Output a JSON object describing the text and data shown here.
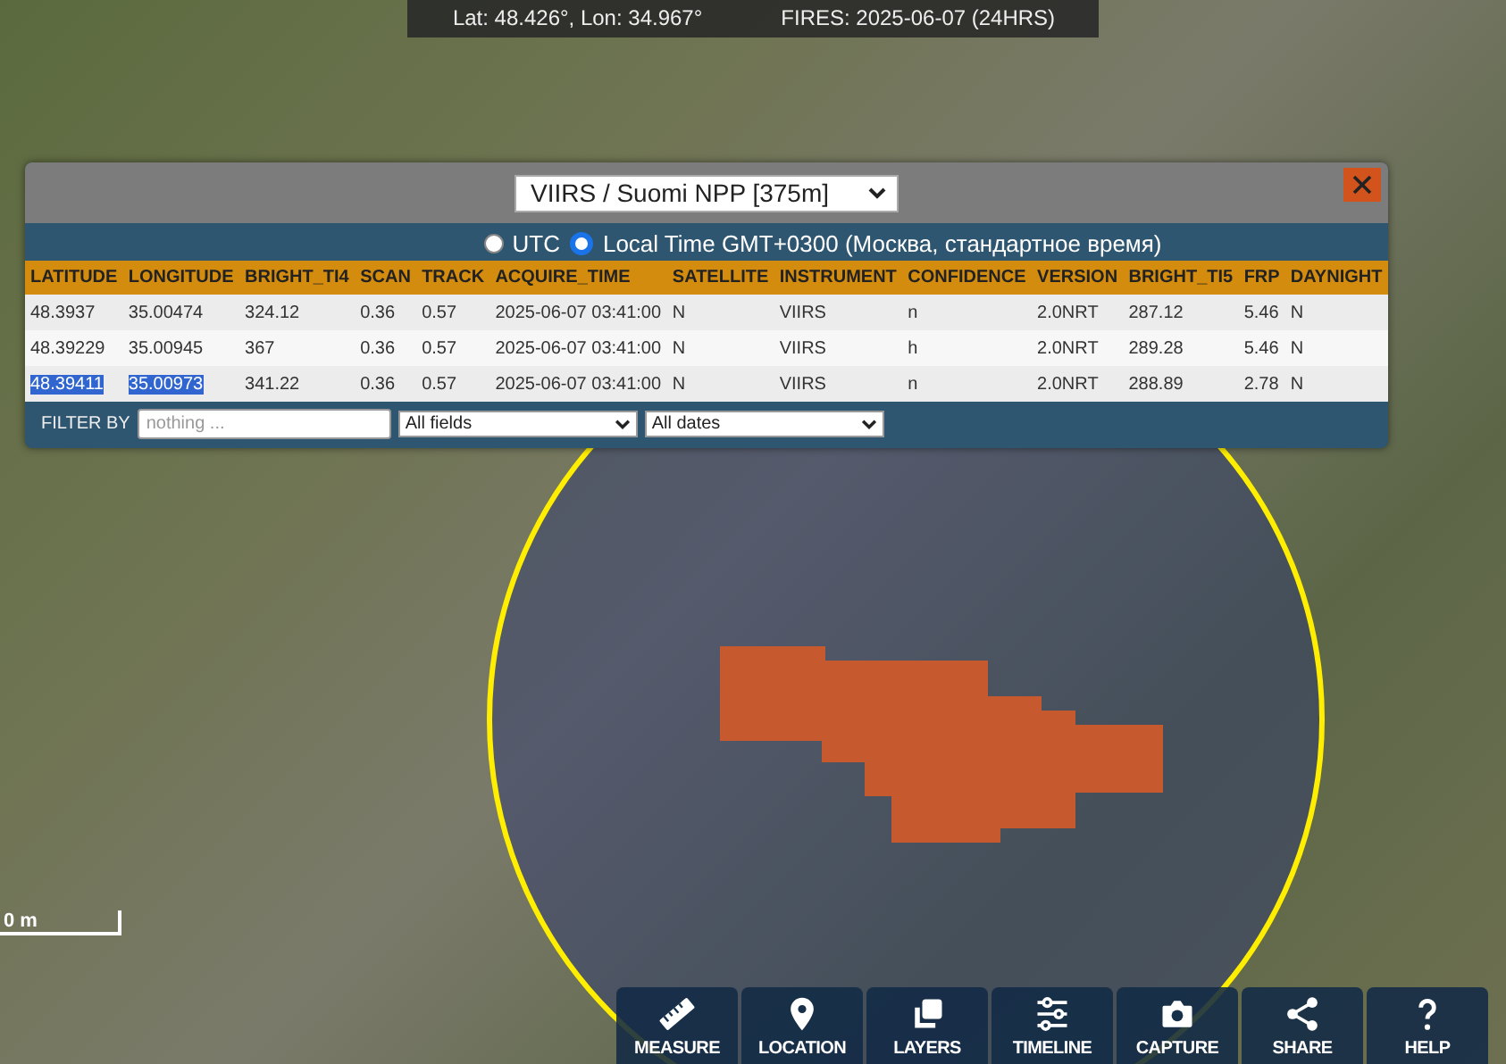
{
  "status_bar": {
    "coordinates": "Lat: 48.426°, Lon: 34.967°",
    "fires": "FIRES: 2025-06-07 (24HRS)"
  },
  "panel": {
    "source_select": "VIIRS / Suomi NPP [375m]",
    "time_options": [
      {
        "label": "UTC",
        "selected": false
      },
      {
        "label": "Local Time GMT+0300 (Москва, стандартное время)",
        "selected": true
      }
    ],
    "table": {
      "columns": [
        "LATITUDE",
        "LONGITUDE",
        "BRIGHT_TI4",
        "SCAN",
        "TRACK",
        "ACQUIRE_TIME",
        "SATELLITE",
        "INSTRUMENT",
        "CONFIDENCE",
        "VERSION",
        "BRIGHT_TI5",
        "FRP",
        "DAYNIGHT"
      ],
      "rows": [
        {
          "cells": [
            {
              "text": "48.3937",
              "highlighted": false
            },
            {
              "text": "35.00474",
              "highlighted": false
            },
            {
              "text": "324.12",
              "highlighted": false
            },
            {
              "text": "0.36",
              "highlighted": false
            },
            {
              "text": "0.57",
              "highlighted": false
            },
            {
              "text": "2025-06-07 03:41:00",
              "highlighted": false
            },
            {
              "text": "N",
              "highlighted": false
            },
            {
              "text": "VIIRS",
              "highlighted": false
            },
            {
              "text": "n",
              "highlighted": false
            },
            {
              "text": "2.0NRT",
              "highlighted": false
            },
            {
              "text": "287.12",
              "highlighted": false
            },
            {
              "text": "5.46",
              "highlighted": false
            },
            {
              "text": "N",
              "highlighted": false
            }
          ]
        },
        {
          "cells": [
            {
              "text": "48.39229",
              "highlighted": false
            },
            {
              "text": "35.00945",
              "highlighted": false
            },
            {
              "text": "367",
              "highlighted": false
            },
            {
              "text": "0.36",
              "highlighted": false
            },
            {
              "text": "0.57",
              "highlighted": false
            },
            {
              "text": "2025-06-07 03:41:00",
              "highlighted": false
            },
            {
              "text": "N",
              "highlighted": false
            },
            {
              "text": "VIIRS",
              "highlighted": false
            },
            {
              "text": "h",
              "highlighted": false
            },
            {
              "text": "2.0NRT",
              "highlighted": false
            },
            {
              "text": "289.28",
              "highlighted": false
            },
            {
              "text": "5.46",
              "highlighted": false
            },
            {
              "text": "N",
              "highlighted": false
            }
          ]
        },
        {
          "cells": [
            {
              "text": "48.39411",
              "highlighted": true
            },
            {
              "text": "35.00973",
              "highlighted": true
            },
            {
              "text": "341.22",
              "highlighted": false
            },
            {
              "text": "0.36",
              "highlighted": false
            },
            {
              "text": "0.57",
              "highlighted": false
            },
            {
              "text": "2025-06-07 03:41:00",
              "highlighted": false
            },
            {
              "text": "N",
              "highlighted": false
            },
            {
              "text": "VIIRS",
              "highlighted": false
            },
            {
              "text": "n",
              "highlighted": false
            },
            {
              "text": "2.0NRT",
              "highlighted": false
            },
            {
              "text": "288.89",
              "highlighted": false
            },
            {
              "text": "2.78",
              "highlighted": false
            },
            {
              "text": "N",
              "highlighted": false
            }
          ]
        }
      ]
    },
    "filter": {
      "label": "FILTER BY",
      "placeholder": "nothing ...",
      "field_select": "All fields",
      "date_select": "All dates"
    }
  },
  "scale_bar": {
    "label": "0 m"
  },
  "toolbar": [
    {
      "kind": "ruler",
      "label": "MEASURE"
    },
    {
      "kind": "pin",
      "label": "LOCATION"
    },
    {
      "kind": "layers",
      "label": "LAYERS"
    },
    {
      "kind": "sliders",
      "label": "TIMELINE"
    },
    {
      "kind": "camera",
      "label": "CAPTURE"
    },
    {
      "kind": "share",
      "label": "SHARE"
    },
    {
      "kind": "help",
      "label": "HELP"
    }
  ]
}
